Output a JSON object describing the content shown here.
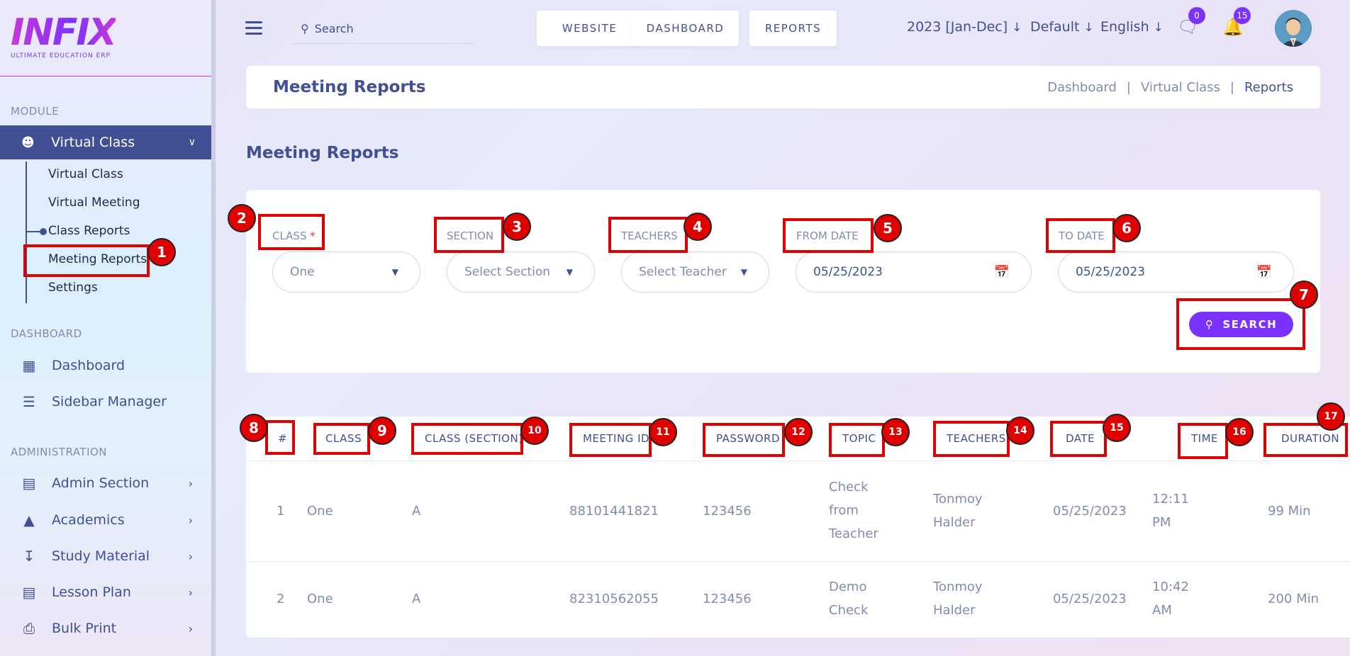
{
  "sidebar": {
    "logo_text": "INFIX",
    "logo_sub": "ULTIMATE EDUCATION ERP",
    "module_title": "MODULE",
    "active_module": "Virtual Class",
    "sub_items": [
      "Virtual Class",
      "Virtual Meeting",
      "Class Reports",
      "Meeting Reports",
      "Settings"
    ],
    "dashboard_title": "DASHBOARD",
    "dashboard_items": [
      "Dashboard",
      "Sidebar Manager"
    ],
    "admin_title": "ADMINISTRATION",
    "admin_items": [
      "Admin Section",
      "Academics",
      "Study Material",
      "Lesson Plan",
      "Bulk Print"
    ]
  },
  "topbar": {
    "search_placeholder": "Search",
    "buttons": [
      "WEBSITE",
      "DASHBOARD",
      "REPORTS"
    ],
    "session": "2023 [Jan-Dec]",
    "theme": "Default",
    "language": "English",
    "messages_count": "0",
    "notifications_count": "15"
  },
  "header": {
    "title": "Meeting Reports",
    "breadcrumbs": [
      "Dashboard",
      "Virtual Class",
      "Reports"
    ]
  },
  "page_title": "Meeting Reports",
  "filters": {
    "class_label": "CLASS",
    "class_required": "*",
    "class_value": "One",
    "section_label": "SECTION",
    "section_value": "Select Section",
    "teachers_label": "TEACHERS",
    "teachers_value": "Select Teacher",
    "from_date_label": "FROM DATE",
    "from_date_value": "05/25/2023",
    "to_date_label": "TO DATE",
    "to_date_value": "05/25/2023",
    "search_button": "SEARCH"
  },
  "table": {
    "columns": [
      "#",
      "CLASS",
      "CLASS (SECTION)",
      "MEETING ID",
      "PASSWORD",
      "TOPIC",
      "TEACHERS",
      "DATE",
      "TIME",
      "DURATION"
    ],
    "rows": [
      {
        "num": "1",
        "class": "One",
        "section": "A",
        "meeting_id": "88101441821",
        "password": "123456",
        "topic": [
          "Check",
          "from",
          "Teacher"
        ],
        "teachers": [
          "Tonmoy",
          "Halder"
        ],
        "date": "05/25/2023",
        "time": [
          "12:11",
          "PM"
        ],
        "duration": "99 Min"
      },
      {
        "num": "2",
        "class": "One",
        "section": "A",
        "meeting_id": "82310562055",
        "password": "123456",
        "topic": [
          "Demo",
          "Check"
        ],
        "teachers": [
          "Tonmoy",
          "Halder"
        ],
        "date": "05/25/2023",
        "time": [
          "10:42",
          "AM"
        ],
        "duration": "200 Min"
      }
    ]
  },
  "annotations": [
    "1",
    "2",
    "3",
    "4",
    "5",
    "6",
    "7",
    "8",
    "9",
    "10",
    "11",
    "12",
    "13",
    "14",
    "15",
    "16",
    "17"
  ],
  "colors": {
    "accent": "#7c32ff",
    "primary": "#415094",
    "muted": "#828bb2",
    "annotation": "#e00000"
  }
}
